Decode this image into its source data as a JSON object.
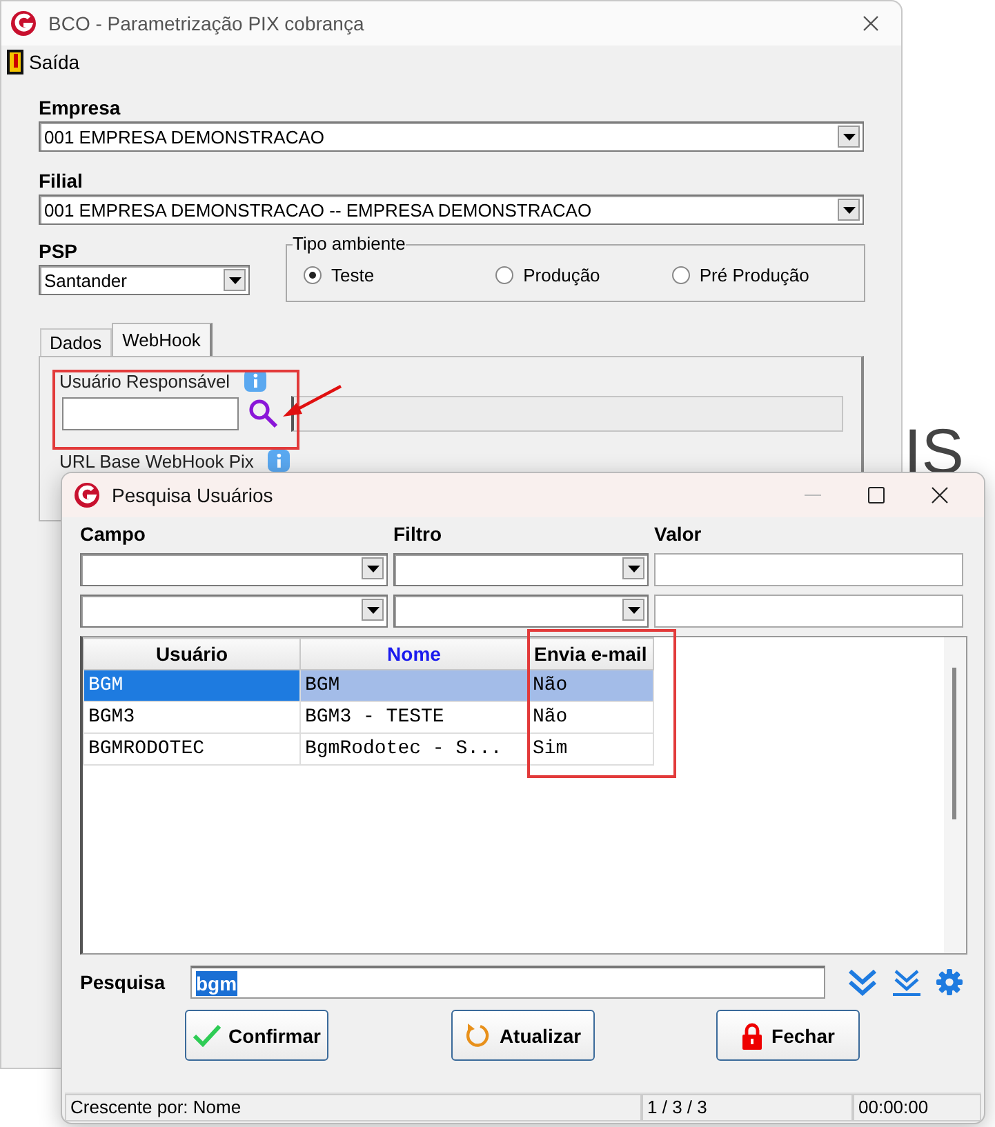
{
  "background": {
    "text": "IS"
  },
  "window": {
    "title": "BCO - Parametrização PIX cobrança",
    "menu": [
      {
        "label": "Saída"
      }
    ],
    "empresa": {
      "label": "Empresa",
      "value": "001 EMPRESA DEMONSTRACAO"
    },
    "filial": {
      "label": "Filial",
      "value": "001 EMPRESA DEMONSTRACAO -- EMPRESA DEMONSTRACAO"
    },
    "psp": {
      "label": "PSP",
      "value": "Santander"
    },
    "tipo_ambiente": {
      "label": "Tipo ambiente",
      "options": [
        {
          "label": "Teste",
          "selected": true
        },
        {
          "label": "Produção",
          "selected": false
        },
        {
          "label": "Pré Produção",
          "selected": false
        }
      ]
    },
    "tabs": [
      {
        "label": "Dados",
        "selected": false
      },
      {
        "label": "WebHook",
        "selected": true
      }
    ],
    "usuario_responsavel": {
      "label": "Usuário Responsável"
    },
    "url_base": {
      "label": "URL Base WebHook Pix"
    }
  },
  "dialog": {
    "title": "Pesquisa Usuários",
    "filter_labels": [
      "Campo",
      "Filtro",
      "Valor"
    ],
    "table": {
      "columns": [
        {
          "label": "Usuário",
          "sorted": false
        },
        {
          "label": "Nome",
          "sorted": true
        },
        {
          "label": "Envia e-mail",
          "sorted": false
        }
      ],
      "rows": [
        {
          "cells": [
            "BGM",
            "BGM",
            "Não"
          ],
          "selected": true
        },
        {
          "cells": [
            "BGM3",
            "BGM3 - TESTE",
            "Não"
          ],
          "selected": false
        },
        {
          "cells": [
            "BGMRODOTEC",
            "BgmRodotec - S...",
            "Sim"
          ],
          "selected": false
        }
      ]
    },
    "search": {
      "label": "Pesquisa",
      "value": "bgm"
    },
    "buttons": [
      {
        "label": "Confirmar",
        "kind": "confirm"
      },
      {
        "label": "Atualizar",
        "kind": "refresh"
      },
      {
        "label": "Fechar",
        "kind": "close"
      }
    ],
    "status_bar": [
      "Crescente por: Nome",
      "1 / 3 / 3",
      "00:00:00"
    ]
  }
}
